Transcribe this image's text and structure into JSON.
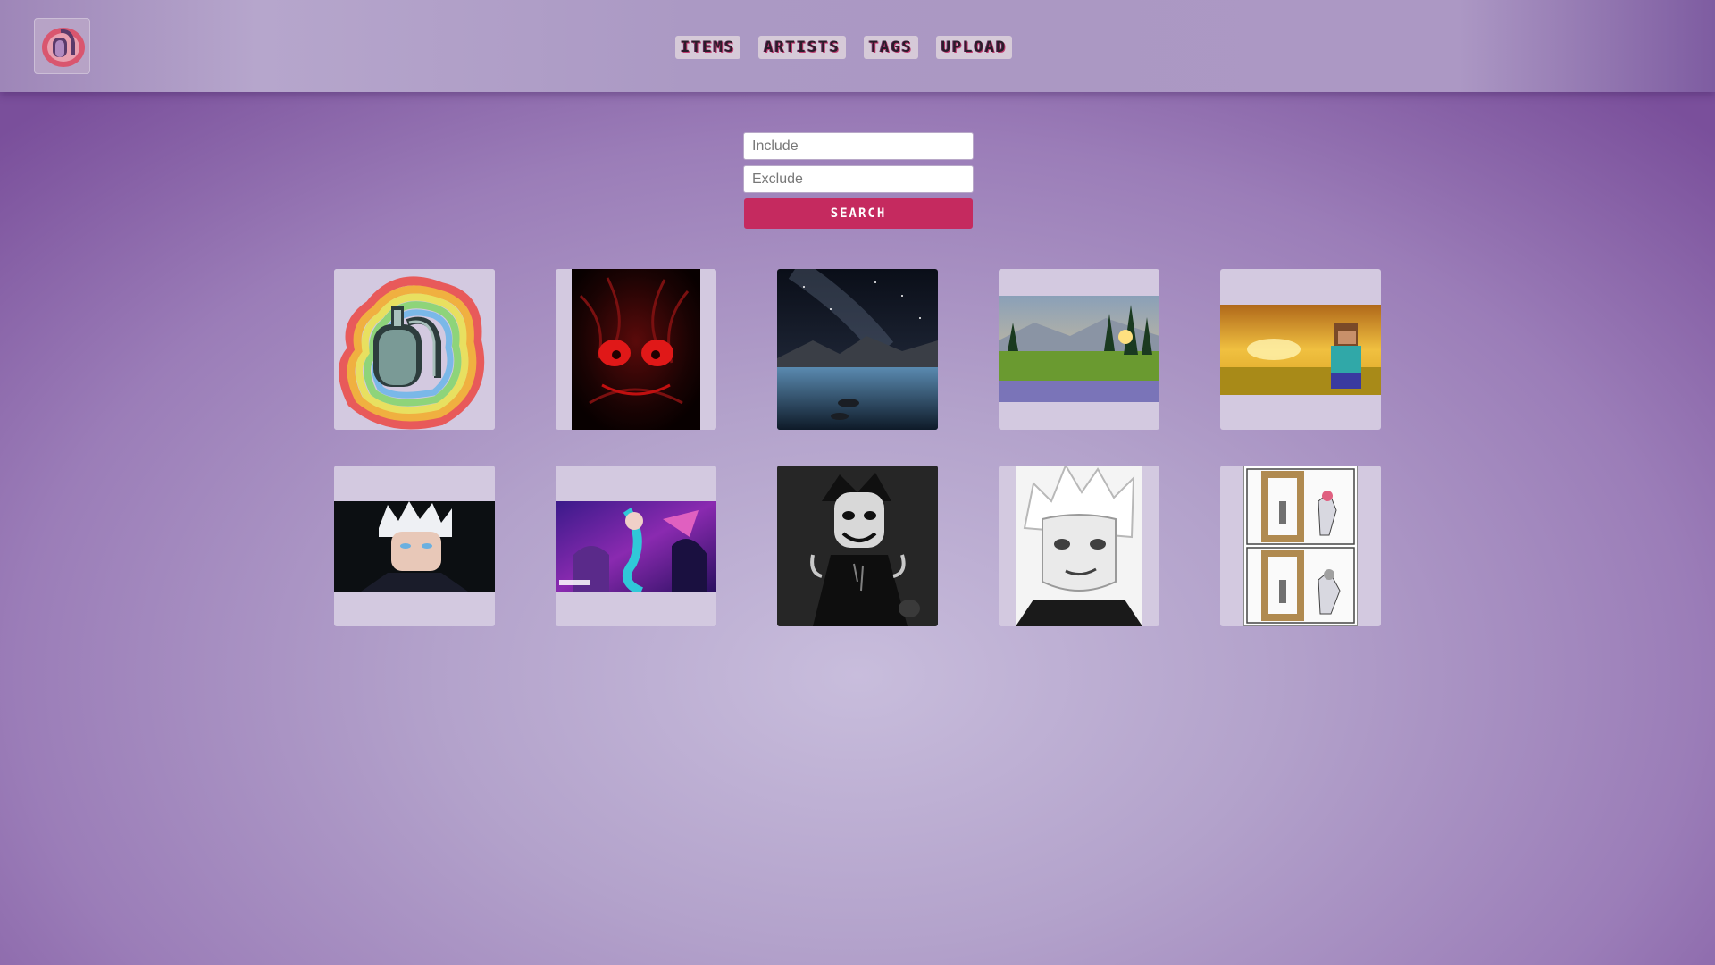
{
  "header": {
    "logo_icon": "tombstone-rainbow-logo-icon",
    "nav": [
      {
        "label": "ITEMS"
      },
      {
        "label": "ARTISTS"
      },
      {
        "label": "TAGS"
      },
      {
        "label": "UPLOAD"
      }
    ]
  },
  "search": {
    "include_placeholder": "Include",
    "exclude_placeholder": "Exclude",
    "include_value": "",
    "exclude_value": "",
    "button_label": "SEARCH"
  },
  "gallery": {
    "items": [
      {
        "thumb": "rainbow-tombstone-logo"
      },
      {
        "thumb": "red-eyed-dark-creature"
      },
      {
        "thumb": "night-lake-milky-way"
      },
      {
        "thumb": "mountain-meadow-sunset"
      },
      {
        "thumb": "blocky-character-golden-field"
      },
      {
        "thumb": "white-haired-anime-character"
      },
      {
        "thumb": "festival-anime-poster"
      },
      {
        "thumb": "monochrome-manga-character-dark"
      },
      {
        "thumb": "monochrome-manga-white-hair"
      },
      {
        "thumb": "manga-comic-panels"
      }
    ]
  },
  "colors": {
    "accent": "#c52a5f",
    "header_bg": "#ab99c4",
    "card_bg": "#d3c9e0"
  }
}
